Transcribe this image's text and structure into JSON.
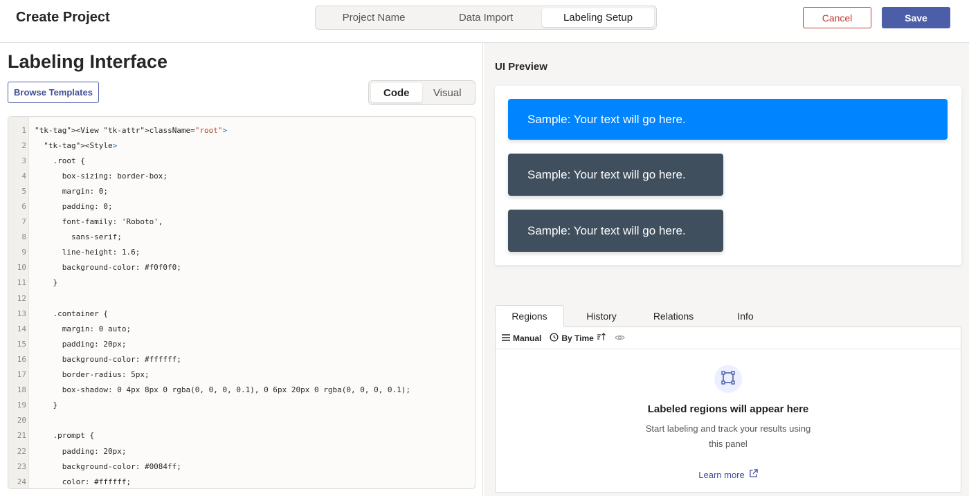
{
  "header": {
    "title": "Create Project",
    "steps": [
      "Project Name",
      "Data Import",
      "Labeling Setup"
    ],
    "active_step": "Labeling Setup",
    "cancel_label": "Cancel",
    "save_label": "Save"
  },
  "left": {
    "title": "Labeling Interface",
    "browse_label": "Browse Templates",
    "modes": [
      "Code",
      "Visual"
    ],
    "active_mode": "Code"
  },
  "code": {
    "line_numbers": [
      "1",
      "2",
      "3",
      "4",
      "5",
      "6",
      "7",
      "8",
      "9",
      "10",
      "11",
      "12",
      "13",
      "14",
      "15",
      "16",
      "17",
      "18",
      "19",
      "20",
      "21",
      "22",
      "23",
      "24"
    ],
    "lines": [
      "<View className=\"root\">",
      "  <Style>",
      "    .root {",
      "      box-sizing: border-box;",
      "      margin: 0;",
      "      padding: 0;",
      "      font-family: 'Roboto',",
      "        sans-serif;",
      "      line-height: 1.6;",
      "      background-color: #f0f0f0;",
      "    }",
      "",
      "    .container {",
      "      margin: 0 auto;",
      "      padding: 20px;",
      "      background-color: #ffffff;",
      "      border-radius: 5px;",
      "      box-shadow: 0 4px 8px 0 rgba(0, 0, 0, 0.1), 0 6px 20px 0 rgba(0, 0, 0, 0.1);",
      "    }",
      "",
      "    .prompt {",
      "      padding: 20px;",
      "      background-color: #0084ff;",
      "      color: #ffffff;"
    ]
  },
  "preview": {
    "label": "UI Preview",
    "prompt_text": "Sample: Your text will go here.",
    "answers": [
      "Sample: Your text will go here.",
      "Sample: Your text will go here."
    ]
  },
  "panel": {
    "tabs": [
      "Regions",
      "History",
      "Relations",
      "Info"
    ],
    "active_tab": "Regions",
    "toolbar": {
      "manual_label": "Manual",
      "sort_label": "By Time"
    },
    "empty_title": "Labeled regions will appear here",
    "empty_desc": "Start labeling and track your results using this panel",
    "learn_more": "Learn more"
  },
  "colors": {
    "accent": "#4c5ea8",
    "danger": "#c0392b",
    "prompt_bg": "#0084ff",
    "answer_bg": "#3f4f5e"
  }
}
